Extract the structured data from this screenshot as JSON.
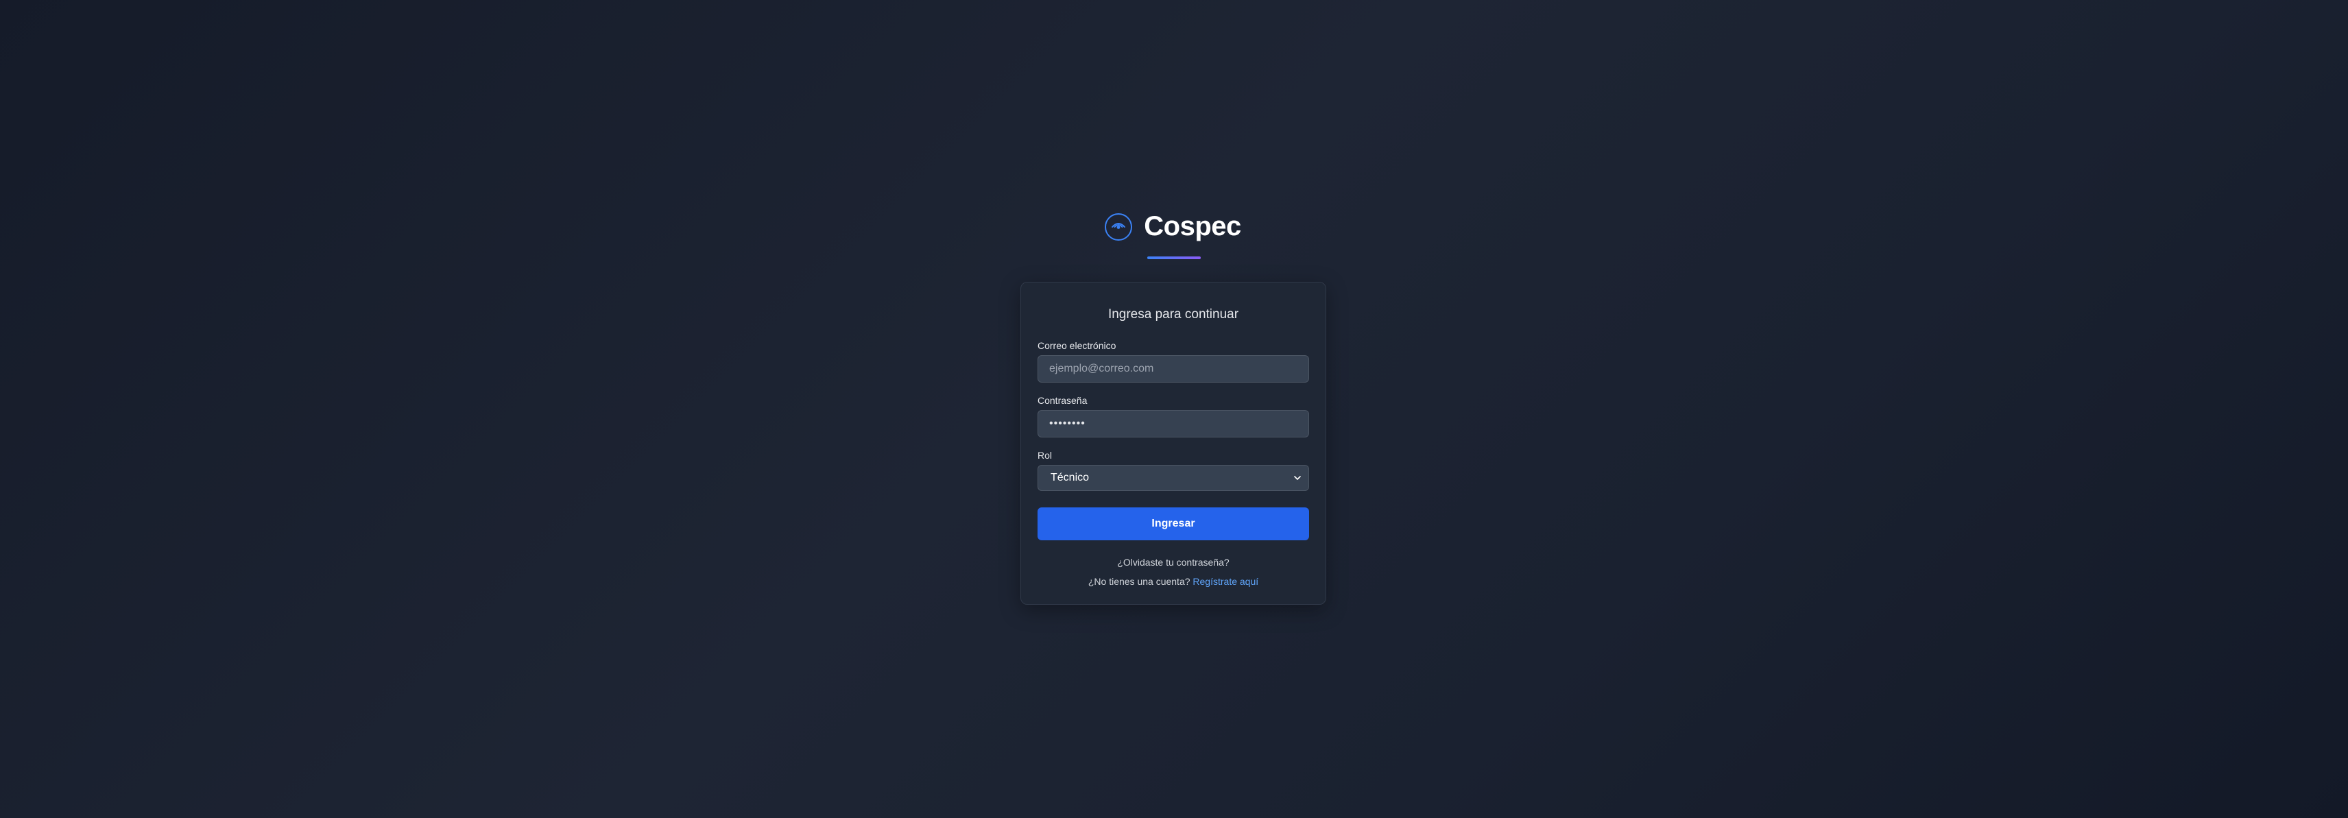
{
  "brand": {
    "name": "Cospec",
    "logo_icon": "eye-signal-icon",
    "accent_color": "#3b82f6",
    "underline_gradient": [
      "#3b82f6",
      "#8b5cf6"
    ]
  },
  "login_card": {
    "title": "Ingresa para continuar",
    "email": {
      "label": "Correo electrónico",
      "placeholder": "ejemplo@correo.com",
      "value": ""
    },
    "password": {
      "label": "Contraseña",
      "value": "••••••••"
    },
    "role": {
      "label": "Rol",
      "selected": "Técnico"
    },
    "submit_label": "Ingresar",
    "forgot_password": "¿Olvidaste tu contraseña?",
    "no_account_text": "¿No tienes una cuenta?",
    "register_link": "Regístrate aquí"
  },
  "colors": {
    "primary_button": "#2563eb",
    "link": "#60a5fa",
    "card_bg": "#1f2735",
    "input_bg": "#364151"
  }
}
